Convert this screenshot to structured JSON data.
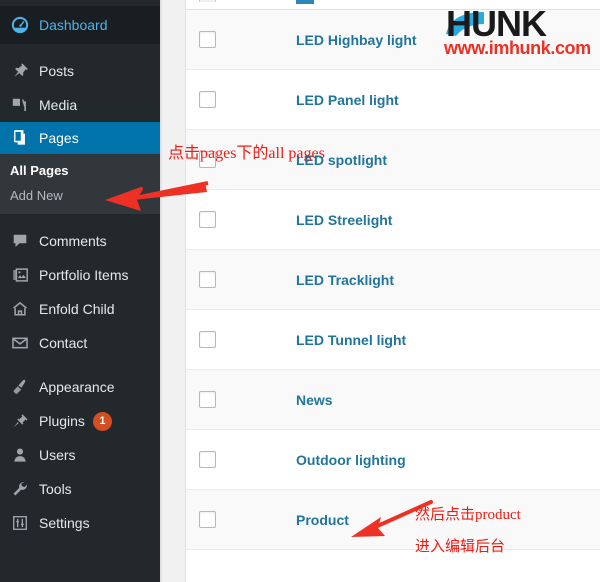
{
  "sidebar": {
    "items": [
      {
        "label": "Dashboard",
        "icon": "dashboard-icon",
        "state": "current-blue-text"
      },
      {
        "label": "Posts",
        "icon": "pin-icon",
        "state": "normal"
      },
      {
        "label": "Media",
        "icon": "media-icon",
        "state": "normal"
      },
      {
        "label": "Pages",
        "icon": "pages-icon",
        "state": "current-highlight"
      },
      {
        "label": "Comments",
        "icon": "comment-bubble-icon",
        "state": "normal"
      },
      {
        "label": "Portfolio Items",
        "icon": "portfolio-icon",
        "state": "normal"
      },
      {
        "label": "Enfold Child",
        "icon": "home-icon",
        "state": "normal"
      },
      {
        "label": "Contact",
        "icon": "envelope-icon",
        "state": "normal"
      },
      {
        "label": "Appearance",
        "icon": "paintbrush-icon",
        "state": "normal"
      },
      {
        "label": "Plugins",
        "icon": "plug-icon",
        "state": "normal",
        "badge": "1"
      },
      {
        "label": "Users",
        "icon": "user-icon",
        "state": "normal"
      },
      {
        "label": "Tools",
        "icon": "wrench-icon",
        "state": "normal"
      },
      {
        "label": "Settings",
        "icon": "sliders-icon",
        "state": "normal"
      }
    ],
    "submenu": {
      "parent": "Pages",
      "items": [
        {
          "label": "All Pages",
          "active": true
        },
        {
          "label": "Add New",
          "active": false
        }
      ]
    },
    "badge_color": "#d54e21",
    "highlight_color": "#0073aa",
    "background_color": "#23282d"
  },
  "pages_table": {
    "link_color": "#21759b",
    "rows": [
      {
        "title": "LED Highbay light",
        "checked": false
      },
      {
        "title": "LED Panel light",
        "checked": false
      },
      {
        "title": "LED spotlight",
        "checked": false
      },
      {
        "title": "LED Streelight",
        "checked": false
      },
      {
        "title": "LED Tracklight",
        "checked": false
      },
      {
        "title": "LED Tunnel light",
        "checked": false
      },
      {
        "title": "News",
        "checked": false
      },
      {
        "title": "Outdoor lighting",
        "checked": false
      },
      {
        "title": "Product",
        "checked": false
      }
    ]
  },
  "watermark": {
    "brand": "HUNK",
    "url": "www.imhunk.com",
    "brand_color": "#1a1a1a",
    "accent_color": "#29abe2",
    "url_color": "#ed3024"
  },
  "annotations": {
    "color": "#f01c14",
    "top_note": "点击pages下的all pages",
    "bottom_note_line1": "然后点击product",
    "bottom_note_line2": "进入编辑后台"
  }
}
